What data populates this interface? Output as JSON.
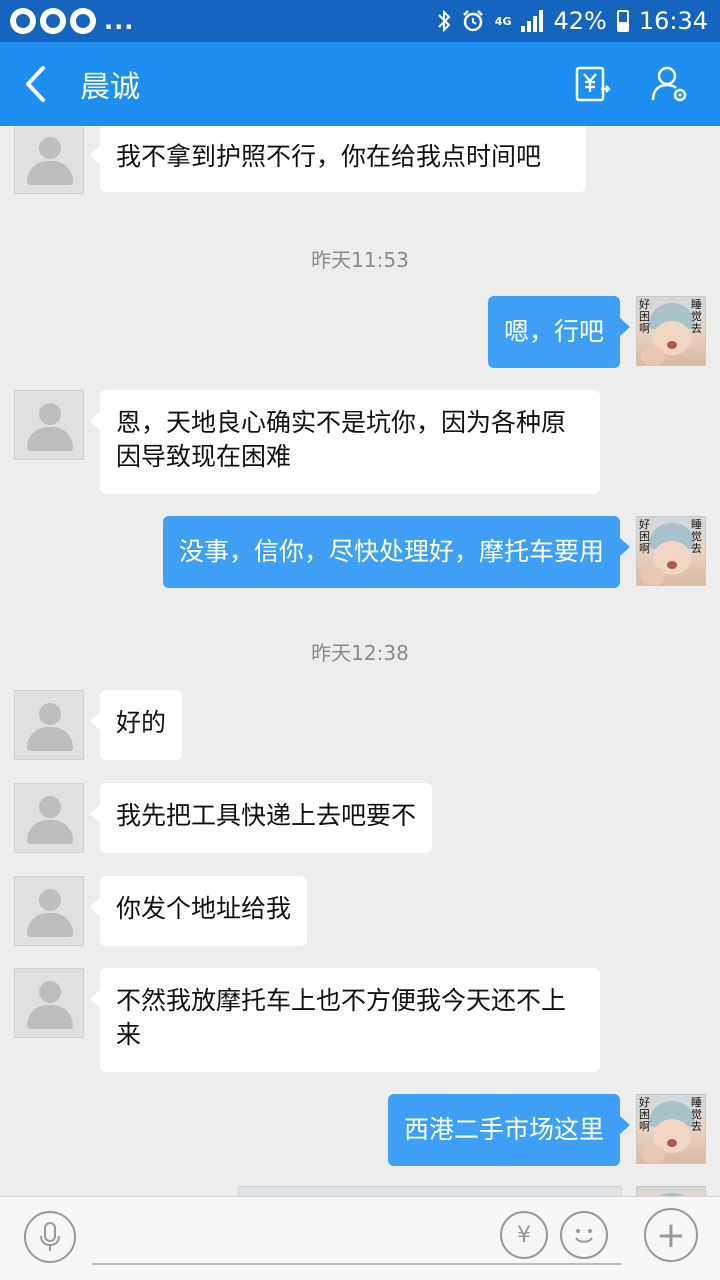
{
  "status_bar": {
    "app_indicators": "...",
    "network": "4G",
    "battery": "42%",
    "time": "16:34"
  },
  "header": {
    "title": "晨诚"
  },
  "messages": [
    {
      "type": "in",
      "text": "我不拿到护照不行，你在给我点时间吧"
    },
    {
      "type": "timestamp",
      "text": "昨天11:53"
    },
    {
      "type": "out",
      "text": "嗯，行吧"
    },
    {
      "type": "in",
      "text": "恩，天地良心确实不是坑你，因为各种原因导致现在困难"
    },
    {
      "type": "out",
      "text": "没事，信你，尽快处理好，摩托车要用"
    },
    {
      "type": "timestamp",
      "text": "昨天12:38"
    },
    {
      "type": "in",
      "text": "好的"
    },
    {
      "type": "in",
      "text": "我先把工具快递上去吧要不"
    },
    {
      "type": "in",
      "text": "你发个地址给我"
    },
    {
      "type": "in",
      "text": "不然我放摩托车上也不方便我今天还不上来"
    },
    {
      "type": "out",
      "text": "西港二手市场这里"
    }
  ],
  "avatar_self_text": {
    "left": "好困啊",
    "right": "睡觉去"
  },
  "input_bar": {
    "placeholder": "",
    "yuan_symbol": "¥",
    "plus_symbol": "+"
  },
  "colors": {
    "header": "#1e8ff0",
    "status_bar": "#1565c0",
    "bubble_out": "#3e9ff5",
    "bubble_in": "#ffffff",
    "background": "#ededed"
  }
}
